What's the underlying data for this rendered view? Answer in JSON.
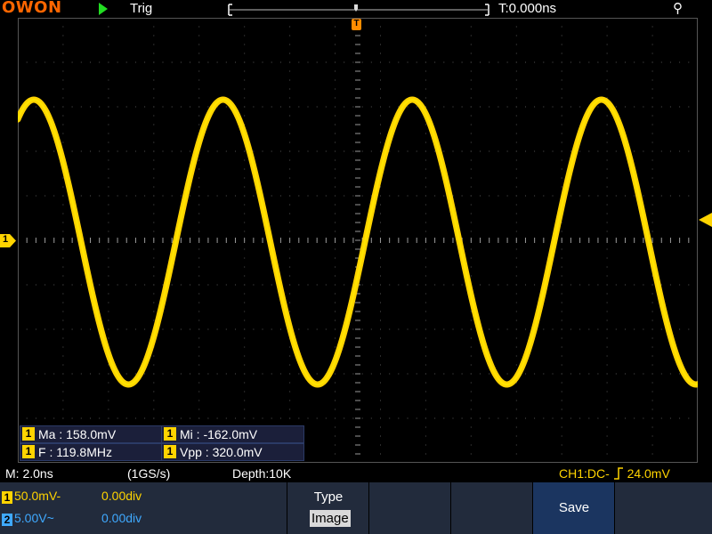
{
  "brand": "OWON",
  "header": {
    "run_state_icon": "play-icon",
    "trig_label": "Trig",
    "time_offset": "T:0.000ns",
    "usb_icon": "usb-icon"
  },
  "markers": {
    "trigger_position_label": "T",
    "channel1_marker": "1"
  },
  "measurements": [
    {
      "channel": "1",
      "label": "Ma : 158.0mV"
    },
    {
      "channel": "1",
      "label": "Mi : -162.0mV"
    },
    {
      "channel": "1",
      "label": "F : 119.8MHz"
    },
    {
      "channel": "1",
      "label": "Vpp : 320.0mV"
    }
  ],
  "status": {
    "timebase": "M: 2.0ns",
    "sample_rate": "(1GS/s)",
    "depth": "Depth:10K",
    "trigger": "CH1:DC-",
    "trigger_level": "24.0mV"
  },
  "channels": [
    {
      "num": "1",
      "scale": "50.0mV",
      "coupling_symbol": "-",
      "offset": "0.00div",
      "color": "#ffd400"
    },
    {
      "num": "2",
      "scale": "5.00V",
      "coupling_symbol": "~",
      "offset": "0.00div",
      "color": "#3fa9ff"
    }
  ],
  "menu": {
    "type_label": "Type",
    "type_value": "Image",
    "save_label": "Save"
  },
  "colors": {
    "channel1": "#ffd400",
    "channel2": "#3fa9ff",
    "menu_bg": "#222b3c",
    "menu_active": "#1b3560",
    "brand": "#ff6600"
  }
}
